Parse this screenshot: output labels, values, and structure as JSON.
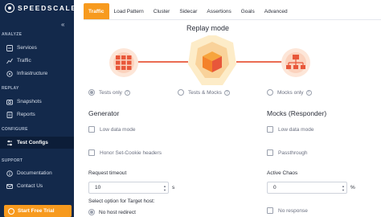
{
  "brand": {
    "name": "SPEEDSCALE",
    "collapse_glyph": "«"
  },
  "sidebar": {
    "sections": {
      "analyze": "ANALYZE",
      "replay": "REPLAY",
      "configure": "CONFIGURE",
      "support": "SUPPORT"
    },
    "items": [
      {
        "label": "Services",
        "icon": "services-icon"
      },
      {
        "label": "Traffic",
        "icon": "traffic-chart-icon"
      },
      {
        "label": "Infrastructure",
        "icon": "infrastructure-icon"
      },
      {
        "label": "Snapshots",
        "icon": "snapshots-icon"
      },
      {
        "label": "Reports",
        "icon": "reports-icon"
      },
      {
        "label": "Test Configs",
        "icon": "test-configs-icon",
        "active": true
      },
      {
        "label": "Documentation",
        "icon": "documentation-icon"
      },
      {
        "label": "Contact Us",
        "icon": "contact-icon"
      }
    ],
    "trial_label": "Start Free Trial"
  },
  "tabs": [
    "Traffic",
    "Load Pattern",
    "Cluster",
    "Sidecar",
    "Assertions",
    "Goals",
    "Advanced"
  ],
  "active_tab": "Traffic",
  "replay_mode": {
    "title": "Replay mode",
    "options": [
      "Tests only",
      "Tests & Mocks",
      "Mocks only"
    ],
    "selected": "Tests only",
    "help_glyph": "?"
  },
  "generator": {
    "heading": "Generator",
    "low_data_mode": "Low data mode",
    "honor_cookie": "Honor Set-Cookie headers",
    "timeout_label": "Request timeout",
    "timeout_value": "10",
    "timeout_unit": "s",
    "target_label": "Select option for Target host:",
    "target_option": "No host redirect"
  },
  "mocks": {
    "heading": "Mocks (Responder)",
    "low_data_mode": "Low data mode",
    "passthrough": "Passthrough",
    "chaos_label": "Active Chaos",
    "chaos_value": "0",
    "chaos_unit": "%",
    "no_response": "No response"
  },
  "colors": {
    "accent": "#f79a1e",
    "sidebar": "#13294b",
    "icon_red": "#e8573a",
    "icon_orange": "#f4822a"
  }
}
